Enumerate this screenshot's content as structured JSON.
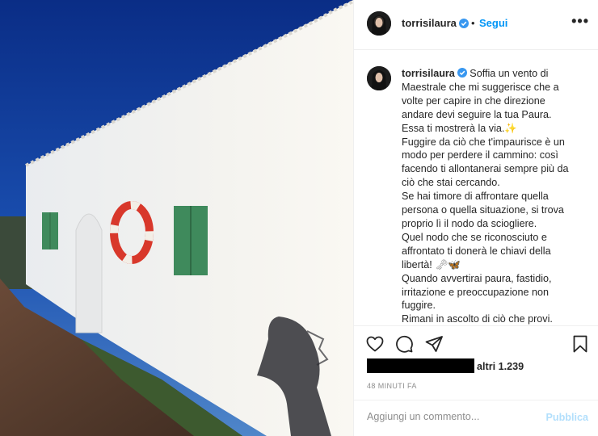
{
  "post": {
    "username": "torrisilaura",
    "follow_label": "Segui",
    "separator": "•",
    "more_label": "•••",
    "caption_lines": [
      "Soffia un vento di",
      "Maestrale che mi suggerisce che a",
      "volte per capire in che direzione",
      "andare devi seguire la tua Paura.",
      "Essa ti mostrerà la via.",
      "Fuggire da ciò che t'impaurisce è un",
      "modo per perdere il cammino: così",
      "facendo ti allontanerai sempre più da",
      "ciò che stai cercando.",
      "Se hai timore di affrontare quella",
      "persona o quella situazione, si trova",
      "proprio lì il nodo da sciogliere.",
      "Quel nodo che se riconosciuto e",
      "affrontato ti donerà le chiavi della",
      "libertà!",
      "Quando avvertirai paura, fastidio,",
      "irritazione e preoccupazione non",
      "fuggire.",
      "Rimani in ascolto di ciò che provi."
    ],
    "emoji": {
      "sparkle": "✨",
      "key": "🗝",
      "butterfly": "🦋"
    },
    "likes_text": "altri 1.239",
    "timestamp": "48 MINUTI FA",
    "comment_placeholder": "Aggiungi un commento...",
    "publish_label": "Pubblica"
  },
  "icons": {
    "verified": "verified-badge-icon",
    "like": "heart-icon",
    "comment": "speech-bubble-icon",
    "share": "paper-plane-icon",
    "save": "bookmark-icon",
    "more": "more-options-icon"
  },
  "colors": {
    "link_blue": "#0095f6",
    "publish_disabled": "#b2dffc",
    "muted": "#8e8e8e",
    "wall_green": "#3f8a5c",
    "lifebuoy_red": "#d8382b"
  }
}
